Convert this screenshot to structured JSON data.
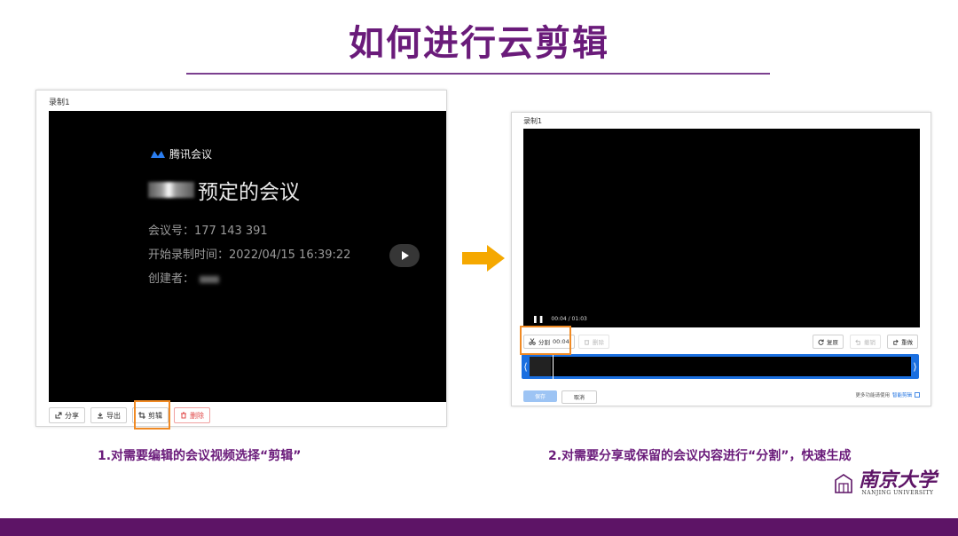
{
  "slide": {
    "title": "如何进行云剪辑",
    "caption_left": "1.对需要编辑的会议视频选择“剪辑”",
    "caption_right": "2.对需要分享或保留的会议内容进行“分割”，快速生成",
    "logo": {
      "cn": "南京大学",
      "en": "NANJING UNIVERSITY"
    },
    "accent_color": "#6a1b7a",
    "highlight_color": "#f08a24",
    "arrow_color": "#f5a800"
  },
  "left_panel": {
    "recording_label": "录制1",
    "video": {
      "brand": "腾讯会议",
      "meeting_title": "预定的会议",
      "meeting_id": "会议号：177 143 391",
      "start_time": "开始录制时间：2022/04/15 16:39:22",
      "creator": "创建者："
    },
    "toolbar": {
      "share": "分享",
      "export": "导出",
      "clip": "剪辑",
      "delete": "删除"
    }
  },
  "right_panel": {
    "recording_label": "录制1",
    "time": "00:04 / 01:03",
    "toolbar": {
      "split": "分割",
      "split_time": "00:04",
      "delete": "删除",
      "reset": "复原",
      "undo": "撤销",
      "redo": "重做"
    },
    "save": "保存",
    "cancel": "取消",
    "more_text": "更多功能请使用",
    "more_link": "智能剪辑"
  }
}
